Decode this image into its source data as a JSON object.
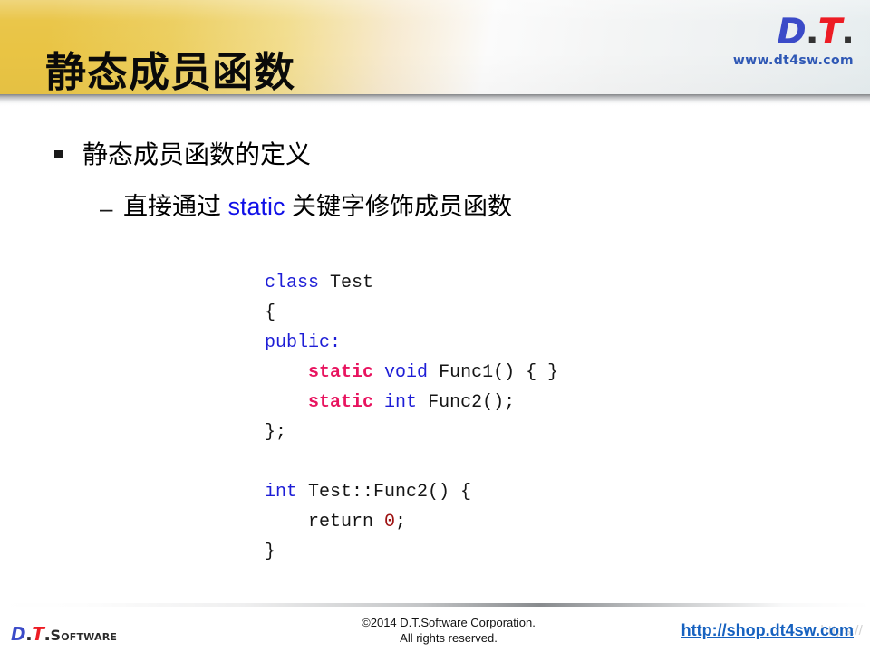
{
  "header": {
    "title": "静态成员函数",
    "logo": {
      "part_d": "D",
      "dot1": ".",
      "part_t": "T",
      "dot2": ".",
      "url": "www.dt4sw.com"
    },
    "accent_gold": "#E9C444",
    "accent_blue": "#3B4BC8",
    "accent_red": "#ED1C24"
  },
  "content": {
    "bullet1": {
      "marker": "square-bullet",
      "text": "静态成员函数的定义"
    },
    "bullet2": {
      "marker": "dash-bullet",
      "text_before": "直接通过 ",
      "keyword": "static",
      "text_after": " 关键字修饰成员函数",
      "keyword_color": "#1010E8"
    }
  },
  "code": {
    "language": "cpp",
    "lines": [
      {
        "tokens": [
          {
            "t": "class",
            "c": "keyword"
          },
          {
            "t": " ",
            "c": "plain"
          },
          {
            "t": "Test",
            "c": "identifier"
          }
        ]
      },
      {
        "tokens": [
          {
            "t": "{",
            "c": "punct"
          }
        ]
      },
      {
        "tokens": [
          {
            "t": "public:",
            "c": "keyword"
          }
        ]
      },
      {
        "tokens": [
          {
            "t": "    ",
            "c": "plain"
          },
          {
            "t": "static",
            "c": "static"
          },
          {
            "t": " ",
            "c": "plain"
          },
          {
            "t": "void",
            "c": "keyword"
          },
          {
            "t": " ",
            "c": "plain"
          },
          {
            "t": "Func1()",
            "c": "identifier"
          },
          {
            "t": " { }",
            "c": "punct"
          }
        ]
      },
      {
        "tokens": [
          {
            "t": "    ",
            "c": "plain"
          },
          {
            "t": "static",
            "c": "static"
          },
          {
            "t": " ",
            "c": "plain"
          },
          {
            "t": "int",
            "c": "keyword"
          },
          {
            "t": " ",
            "c": "plain"
          },
          {
            "t": "Func2();",
            "c": "identifier"
          }
        ]
      },
      {
        "tokens": [
          {
            "t": "};",
            "c": "punct"
          }
        ]
      },
      {
        "tokens": []
      },
      {
        "tokens": [
          {
            "t": "int",
            "c": "keyword"
          },
          {
            "t": " ",
            "c": "plain"
          },
          {
            "t": "Test::Func2() {",
            "c": "identifier"
          }
        ]
      },
      {
        "tokens": [
          {
            "t": "    return ",
            "c": "identifier"
          },
          {
            "t": "0",
            "c": "number"
          },
          {
            "t": ";",
            "c": "punct"
          }
        ]
      },
      {
        "tokens": [
          {
            "t": "}",
            "c": "punct"
          }
        ]
      }
    ],
    "colors": {
      "keyword": "#1D1DD6",
      "static": "#E8145F",
      "identifier": "#151515",
      "number": "#9E1212",
      "punct": "#151515"
    }
  },
  "footer": {
    "logo": {
      "part_d": "D",
      "dot1": ".",
      "part_t": "T",
      "dot2": ".",
      "word": "Software"
    },
    "copyright_line1": "©2014 D.T.Software Corporation.",
    "copyright_line2": "All rights reserved.",
    "watermark": "https://",
    "link": "http://shop.dt4sw.com"
  }
}
